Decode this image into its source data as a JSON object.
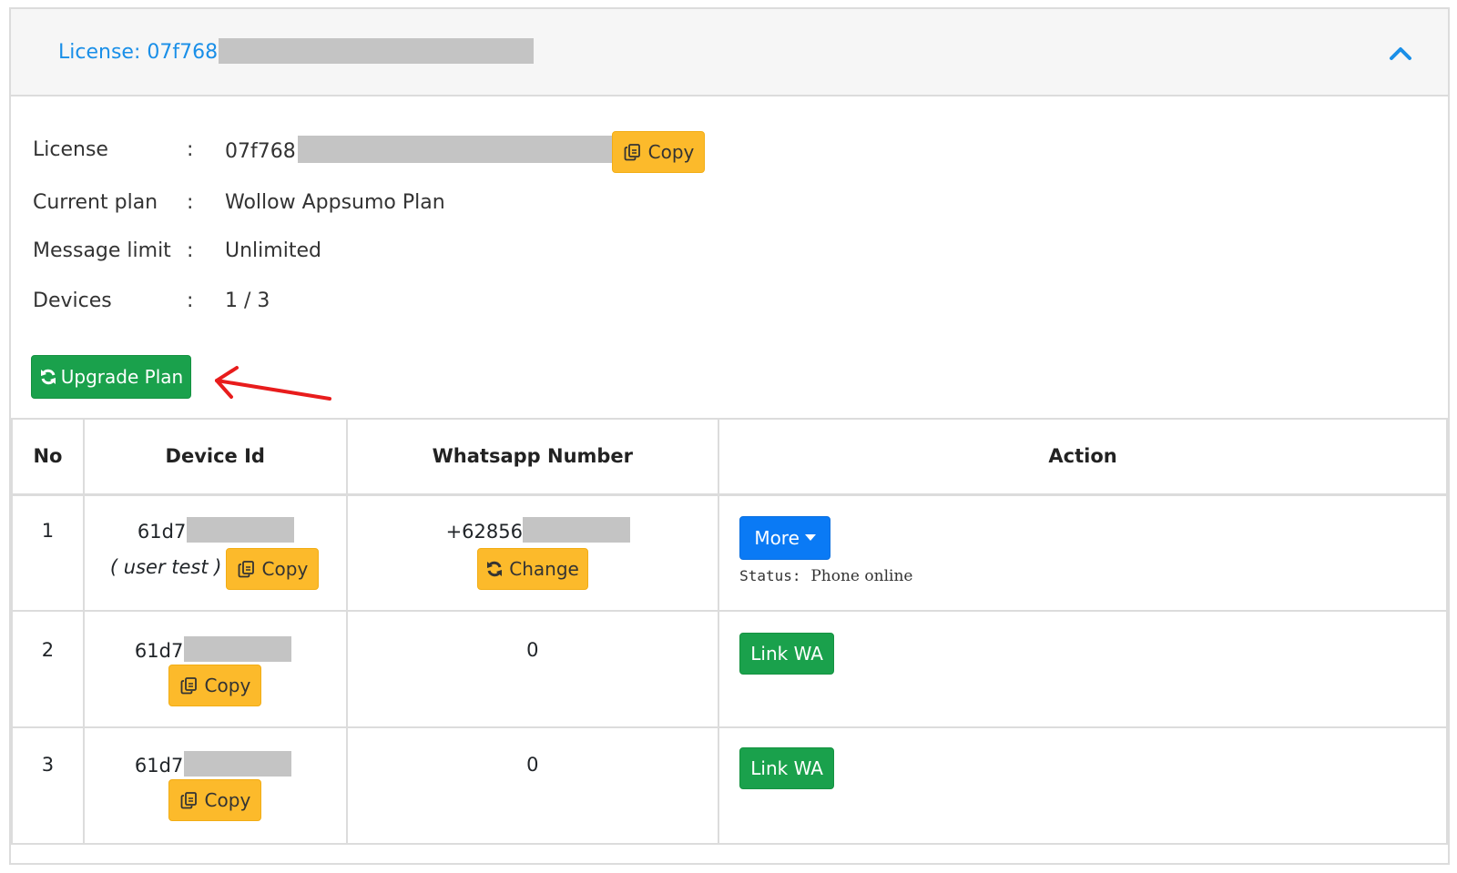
{
  "header": {
    "title": "License: 07f768"
  },
  "info": {
    "license_label": "License",
    "license_value": "07f768",
    "copy_label": "Copy",
    "plan_label": "Current plan",
    "plan_value": "Wollow Appsumo Plan",
    "limit_label": "Message limit",
    "limit_value": "Unlimited",
    "devices_label": "Devices",
    "devices_value": "1 / 3",
    "colon": ":"
  },
  "upgrade_button": "Upgrade Plan",
  "table": {
    "headers": [
      "No",
      "Device Id",
      "Whatsapp Number",
      "Action"
    ],
    "rows": [
      {
        "no": "1",
        "device_id": "61d7",
        "device_name": "( user test )",
        "copy": "Copy",
        "whatsapp": "+62856",
        "change": "Change",
        "action_button": "More",
        "status_label": "Status:",
        "status_value": "Phone online"
      },
      {
        "no": "2",
        "device_id": "61d7",
        "copy": "Copy",
        "whatsapp": "0",
        "action_button": "Link WA"
      },
      {
        "no": "3",
        "device_id": "61d7",
        "copy": "Copy",
        "whatsapp": "0",
        "action_button": "Link WA"
      }
    ]
  },
  "colors": {
    "accent_blue": "#1a8fe8",
    "warning": "#fcba2b",
    "success": "#1aa14c",
    "primary": "#0a7af5",
    "annotation_arrow": "#e81c1c"
  }
}
